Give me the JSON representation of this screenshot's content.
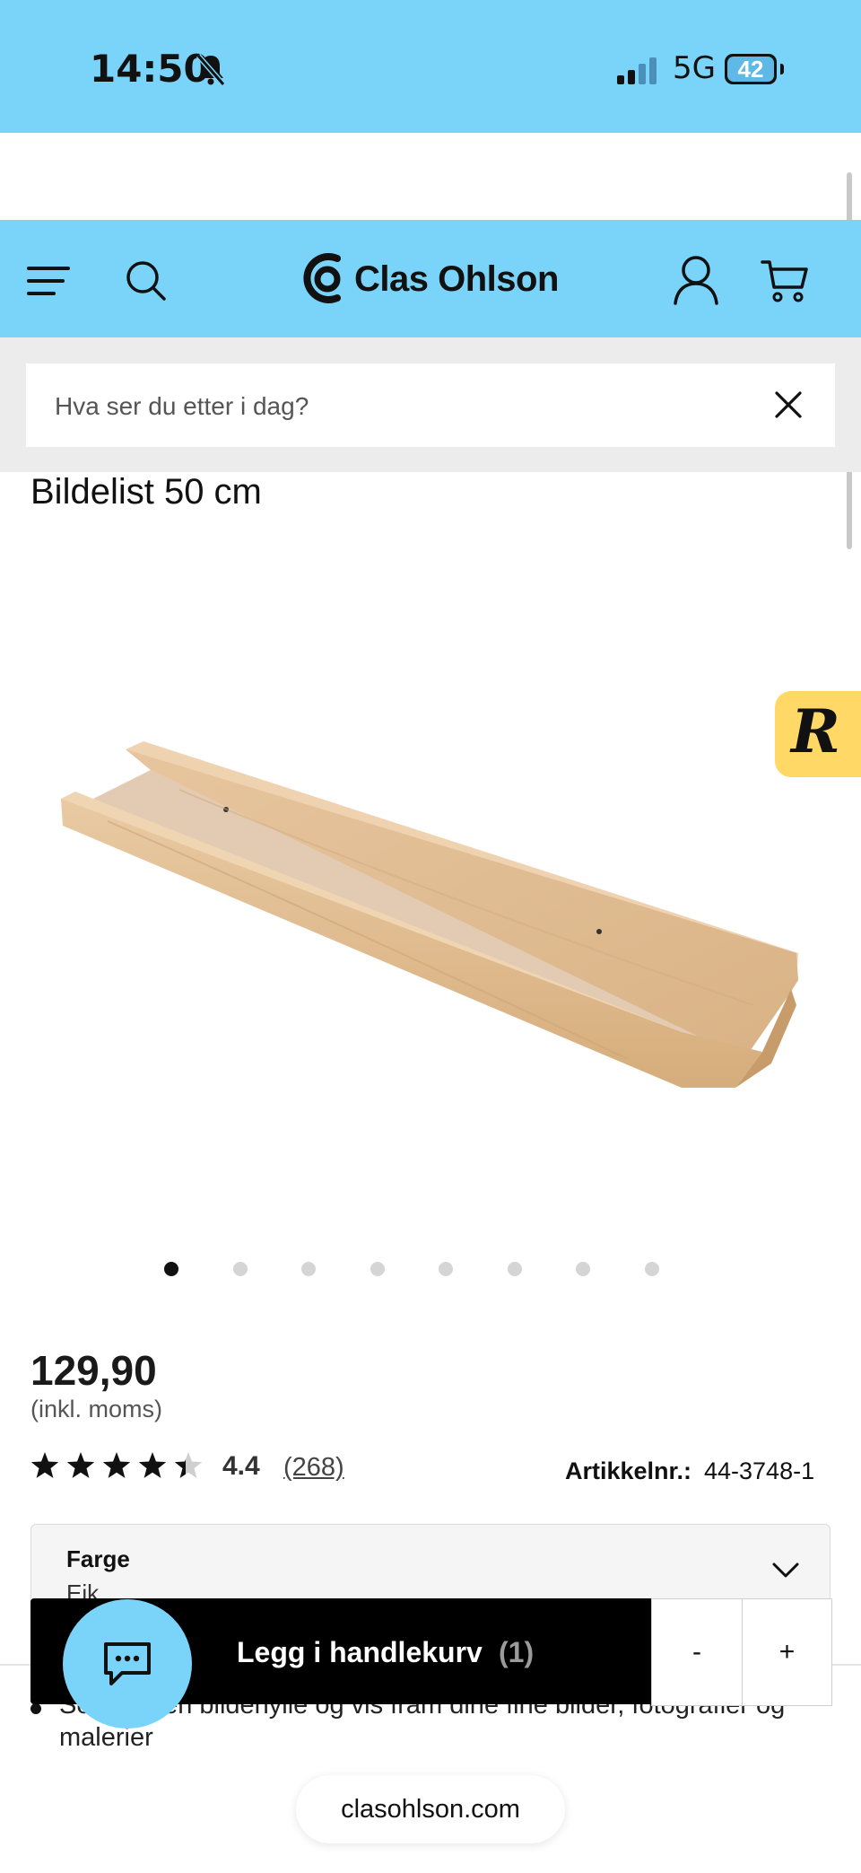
{
  "status_bar": {
    "time": "14:50",
    "network": "5G",
    "battery": "42"
  },
  "header": {
    "brand": "Clas Ohlson",
    "brand_color": "#7ad4f9"
  },
  "search": {
    "placeholder": "Hva ser du etter i dag?"
  },
  "product": {
    "title": "Bildelist 50 cm",
    "price": "129,90",
    "vat_note": "(inkl. moms)",
    "rating": "4.4",
    "rating_value": 4.4,
    "reviews": "(268)",
    "article_label": "Artikkelnr.:",
    "article_number": "44-3748-1",
    "color_label": "Farge",
    "color_value": "Eik",
    "description": "Sett opp en bildehylle og vis fram dine fine bilder, fotografier og malerier"
  },
  "carousel": {
    "total": 8,
    "active": 1
  },
  "cart": {
    "button_label": "Legg i handlekurv",
    "count": "(1)",
    "minus": "-",
    "plus": "+"
  },
  "badge_letter": "R",
  "url": "clasohlson.com"
}
